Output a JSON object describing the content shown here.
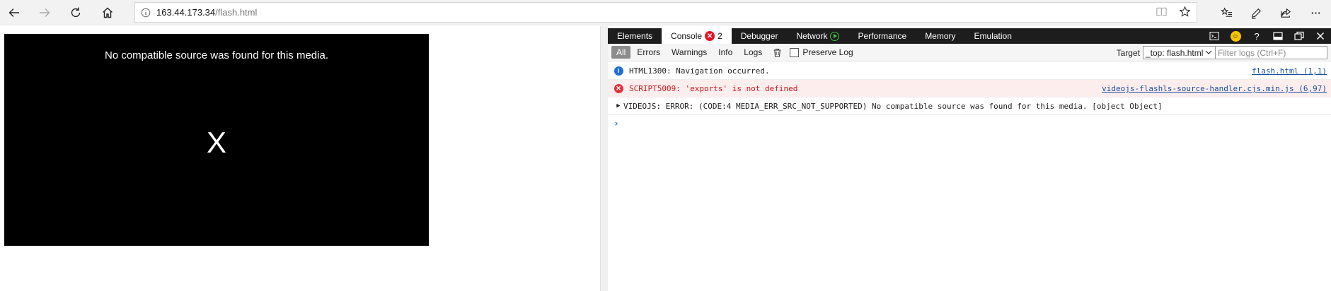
{
  "browser": {
    "url_host": "163.44.173.34",
    "url_path": "/flash.html"
  },
  "page": {
    "video_error_message": "No compatible source was found for this media.",
    "video_error_glyph": "X"
  },
  "devtools": {
    "tabs": [
      {
        "label": "Elements"
      },
      {
        "label": "Console",
        "error_count": "2"
      },
      {
        "label": "Debugger"
      },
      {
        "label": "Network"
      },
      {
        "label": "Performance"
      },
      {
        "label": "Memory"
      },
      {
        "label": "Emulation"
      }
    ],
    "filters": {
      "all": "All",
      "errors": "Errors",
      "warnings": "Warnings",
      "info": "Info",
      "logs": "Logs",
      "preserve_log": "Preserve Log",
      "target_label": "Target",
      "target_value": "_top: flash.html",
      "filter_placeholder": "Filter logs (Ctrl+F)"
    },
    "console": [
      {
        "level": "info",
        "message": "HTML1300: Navigation occurred.",
        "source": "flash.html (1,1)"
      },
      {
        "level": "error",
        "message": "SCRIPT5009: 'exports' is not defined",
        "source": "videojs-flashls-source-handler.cjs.min.js (6,97)"
      },
      {
        "level": "log",
        "message": "VIDEOJS: ERROR: (CODE:4 MEDIA_ERR_SRC_NOT_SUPPORTED) No compatible source was found for this media. [object Object]"
      }
    ],
    "prompt": "›"
  },
  "colors": {
    "devtools_tab_bar": "#1d1d1d",
    "error_red": "#e81123",
    "info_blue": "#1e6fd4",
    "link_blue": "#1a4fa0"
  }
}
